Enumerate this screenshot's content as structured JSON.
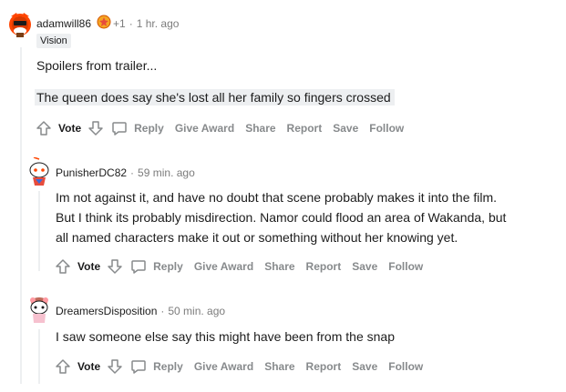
{
  "comments": [
    {
      "username": "adamwill86",
      "award_count": "+1",
      "time": "1 hr. ago",
      "flair": "Vision",
      "paragraphs": [
        "Spoilers from trailer..."
      ],
      "quote": "The queen does say she's lost all her family so fingers crossed"
    },
    {
      "username": "PunisherDC82",
      "time": "59 min. ago",
      "paragraphs": [
        "Im not against it, and have no doubt that scene probably makes it into the film.",
        "But I think its probably misdirection. Namor could flood an area of Wakanda, but",
        "all named characters make it out or something without her knowing yet."
      ]
    },
    {
      "username": "DreamersDisposition",
      "time": "50 min. ago",
      "paragraphs": [
        "I saw someone else say this might have been from the snap"
      ]
    }
  ],
  "actions": {
    "vote": "Vote",
    "reply": "Reply",
    "give_award": "Give Award",
    "share": "Share",
    "report": "Report",
    "save": "Save",
    "follow": "Follow"
  },
  "separator": "·",
  "colors": {
    "meta": "#7c7c7c",
    "action": "#878a8c",
    "quote_bg": "#edeff1",
    "thread_line": "#edeff1"
  }
}
